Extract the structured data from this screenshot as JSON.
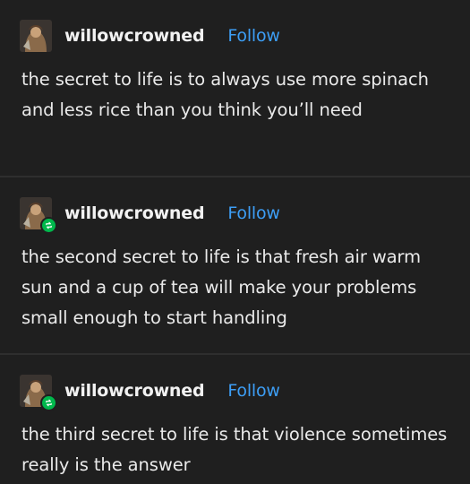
{
  "posts": [
    {
      "username": "willowcrowned",
      "follow_label": "Follow",
      "text": "the secret to life is to always use more spinach and less rice than you think you’ll need",
      "reblog": false
    },
    {
      "username": "willowcrowned",
      "follow_label": "Follow",
      "text": "the second secret to life is that fresh air warm sun and a cup of tea will make your problems small enough to start handling",
      "reblog": true
    },
    {
      "username": "willowcrowned",
      "follow_label": "Follow",
      "text": "the third secret to life is that violence sometimes really is the answer",
      "reblog": true
    }
  ],
  "colors": {
    "background": "#1f1f1f",
    "divider": "#2e2e2e",
    "link": "#3d9ef5",
    "reblog_badge": "#00b84c"
  },
  "icons": {
    "avatar": "avatar-image",
    "reblog": "reblog-icon"
  }
}
